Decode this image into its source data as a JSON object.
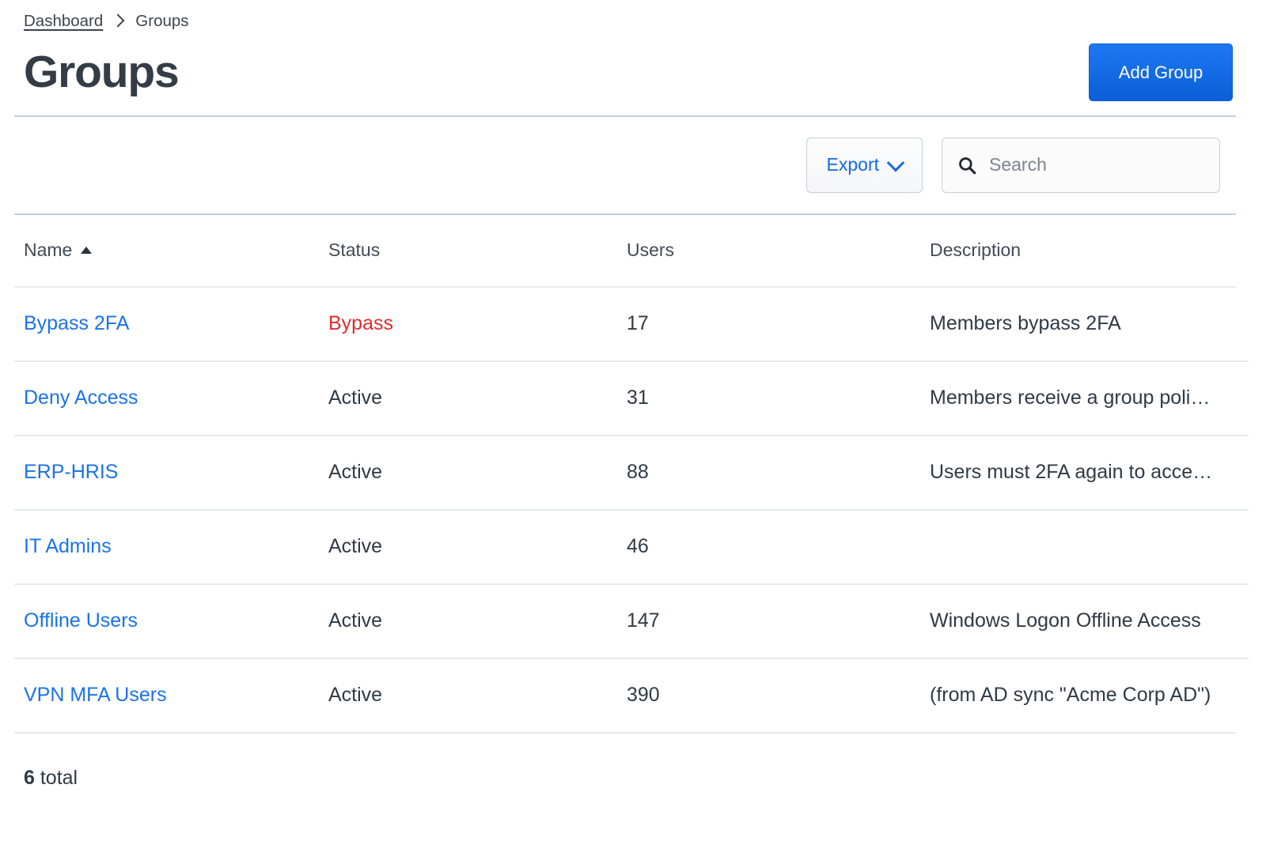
{
  "breadcrumb": {
    "parent": "Dashboard",
    "current": "Groups",
    "separator_icon": "chevron-right-icon"
  },
  "header": {
    "title": "Groups",
    "add_button_label": "Add Group"
  },
  "toolbar": {
    "export_label": "Export",
    "export_chevron_icon": "chevron-down-icon",
    "search_placeholder": "Search",
    "search_value": "",
    "search_icon": "search-icon"
  },
  "table": {
    "columns": [
      {
        "key": "name",
        "label": "Name",
        "sorted": "asc",
        "sort_icon": "caret-up-icon"
      },
      {
        "key": "status",
        "label": "Status",
        "sorted": "none"
      },
      {
        "key": "users",
        "label": "Users",
        "sorted": "none"
      },
      {
        "key": "description",
        "label": "Description",
        "sorted": "none"
      }
    ],
    "rows": [
      {
        "name": "Bypass 2FA",
        "status": "Bypass",
        "status_kind": "bypass",
        "users": "17",
        "description": "Members bypass 2FA"
      },
      {
        "name": "Deny Access",
        "status": "Active",
        "status_kind": "active",
        "users": "31",
        "description": "Members receive a group poli…"
      },
      {
        "name": "ERP-HRIS",
        "status": "Active",
        "status_kind": "active",
        "users": "88",
        "description": "Users must 2FA again to acce…"
      },
      {
        "name": "IT Admins",
        "status": "Active",
        "status_kind": "active",
        "users": "46",
        "description": ""
      },
      {
        "name": "Offline Users",
        "status": "Active",
        "status_kind": "active",
        "users": "147",
        "description": "Windows Logon Offline Access"
      },
      {
        "name": "VPN MFA Users",
        "status": "Active",
        "status_kind": "active",
        "users": "390",
        "description": "(from AD sync \"Acme Corp AD\")"
      }
    ]
  },
  "footer": {
    "total_count": "6",
    "total_label": "total"
  },
  "colors": {
    "link_blue": "#1a73e8",
    "primary_button_blue": "#0b5fd8",
    "status_bypass_red": "#e02d2d",
    "text_dark": "#2f3a45",
    "divider_strong": "#c4cfdb",
    "divider_row": "#e6eaef"
  }
}
